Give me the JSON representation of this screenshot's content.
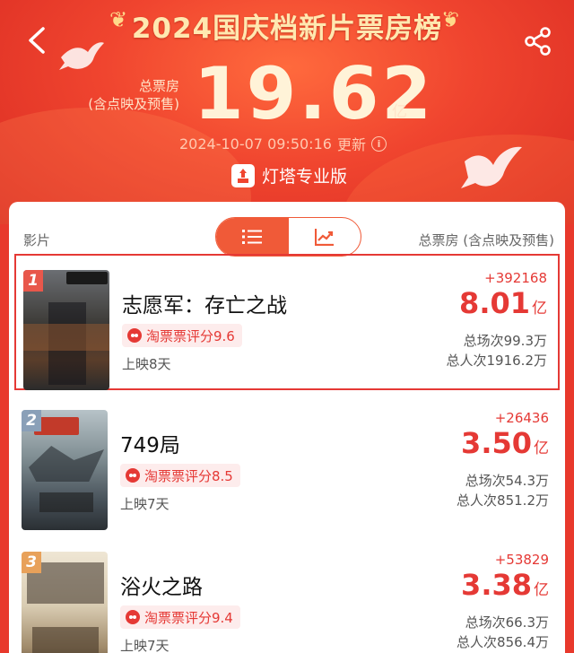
{
  "header": {
    "title": "2024国庆档新片票房榜",
    "total_label_line1": "总票房",
    "total_label_line2": "(含点映及预售)",
    "total_value": "19.62",
    "total_unit": "亿",
    "updated_time": "2024-10-07 09:50:16",
    "updated_suffix": "更新",
    "brand": "灯塔专业版"
  },
  "list_header": {
    "left": "影片",
    "right": "总票房 (含点映及预售)"
  },
  "colors": {
    "accent": "#e53935",
    "header_red": "#f0452f",
    "toggle_orange": "#f05a38"
  },
  "movies": [
    {
      "rank": "1",
      "title": "志愿军：存亡之战",
      "rating": "淘票票评分9.6",
      "days": "上映8天",
      "delta": "+392168",
      "gross": "8.01",
      "gross_unit": "亿",
      "screenings": "总场次99.3万",
      "admissions": "总人次1916.2万"
    },
    {
      "rank": "2",
      "title": "749局",
      "rating": "淘票票评分8.5",
      "days": "上映7天",
      "delta": "+26436",
      "gross": "3.50",
      "gross_unit": "亿",
      "screenings": "总场次54.3万",
      "admissions": "总人次851.2万"
    },
    {
      "rank": "3",
      "title": "浴火之路",
      "rating": "淘票票评分9.4",
      "days": "上映7天",
      "delta": "+53829",
      "gross": "3.38",
      "gross_unit": "亿",
      "screenings": "总场次66.3万",
      "admissions": "总人次856.4万"
    }
  ],
  "icons": [
    "back-icon",
    "share-icon",
    "info-icon",
    "list-view-icon",
    "chart-view-icon",
    "rating-icon",
    "dove-icon",
    "wheat-icon"
  ]
}
